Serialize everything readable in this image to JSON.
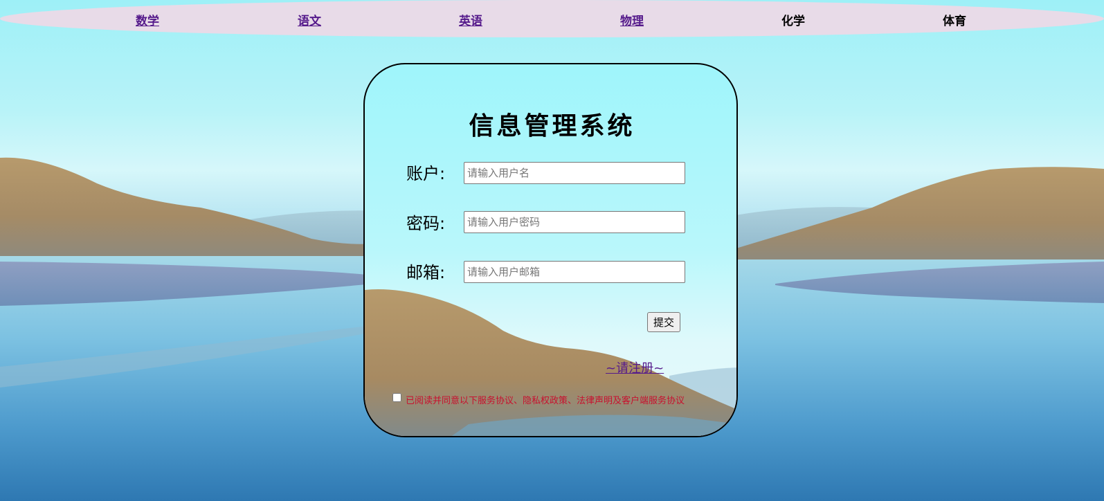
{
  "nav": {
    "items": [
      {
        "label": "数学"
      },
      {
        "label": "语文"
      },
      {
        "label": "英语"
      },
      {
        "label": "物理"
      },
      {
        "label": "化学"
      },
      {
        "label": "体育"
      }
    ]
  },
  "login": {
    "title": "信息管理系统",
    "account_label": "账户:",
    "account_placeholder": "请输入用户名",
    "password_label": "密码:",
    "password_placeholder": "请输入用户密码",
    "email_label": "邮箱:",
    "email_placeholder": "请输入用户邮箱",
    "submit_label": "提交",
    "register_link": "~请注册~",
    "agreement_text": "已阅读并同意以下服务协议、隐私权政策、法律声明及客户端服务协议",
    "agreement_checked": false
  },
  "colors": {
    "nav_bg": "#e8dbe8",
    "link": "#551a8b",
    "agreement_text": "#c8102e"
  }
}
